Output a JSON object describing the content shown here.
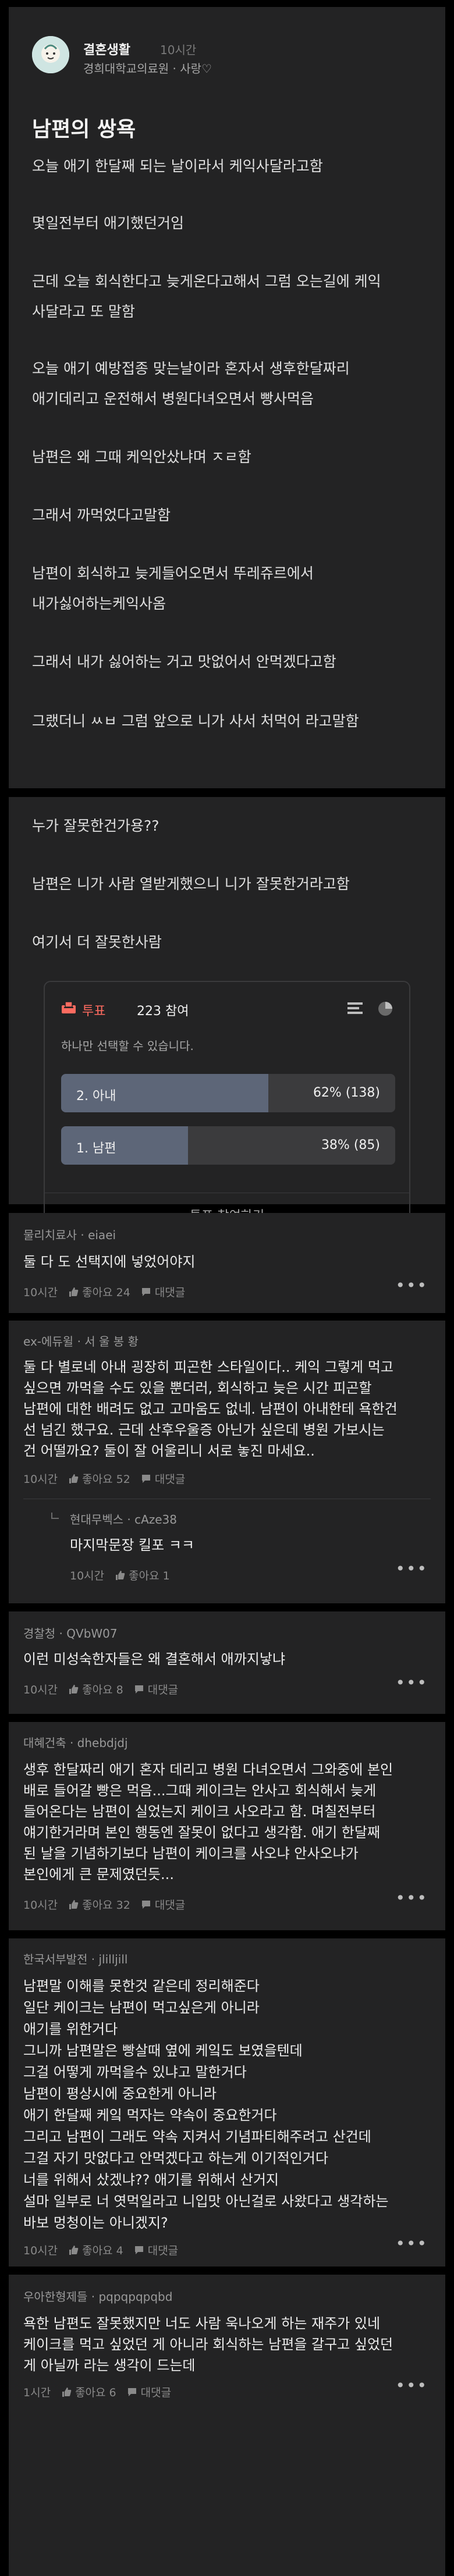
{
  "post": {
    "author": "결혼생활",
    "time": "10시간",
    "board": "경희대학교의료원 · 사랑♡",
    "title": "남편의 쌍욕",
    "lines": [
      "오늘 애기 한달째 되는 날이라서 케익사달라고함",
      "몇일전부터 애기했던거임",
      "근데 오늘 회식한다고 늦게온다고해서 그럼 오는길에 케익",
      "사달라고 또 말함",
      "오늘 애기 예방접종 맞는날이라 혼자서 생후한달짜리",
      "애기데리고 운전해서 병원다녀오면서 빵사먹음",
      "남편은 왜 그때 케익안샀냐며 ㅈㄹ함",
      "그래서 까먹었다고말함",
      "남편이 회식하고 늦게들어오면서 뚜레쥬르에서",
      "내가싫어하는케익사옴",
      "그래서 내가 싫어하는 거고 맛없어서 안먹겠다고함",
      "그랬더니 ㅆㅂ 그럼 앞으로 니가 사서 처먹어 라고말함"
    ]
  },
  "question": {
    "lines": [
      "누가 잘못한건가용??",
      "남편은 니가 사람 열받게했으니 니가 잘못한거라고함",
      "여기서 더 잘못한사람"
    ]
  },
  "poll": {
    "tag": "투표",
    "count": "223 참여",
    "note": "하나만 선택할 수 있습니다.",
    "options": [
      {
        "label": "2. 아내",
        "pct": "62% (138)",
        "fraction": 0.62
      },
      {
        "label": "1. 남편",
        "pct": "38% (85)",
        "fraction": 0.38
      }
    ],
    "join": "투표 참여하기"
  },
  "comments": [
    {
      "meta": "물리치료사 · eiaei",
      "lines": [
        "둘 다 도 선택지에 넣었어야지"
      ],
      "time": "10시간",
      "likes": "좋아요 24",
      "reply": "대댓글"
    },
    {
      "meta": "ex-에듀윌 · 서 울 봉 황",
      "lines": [
        "둘 다 별로네 아내 굉장히 피곤한 스타일이다.. 케익 그렇게 먹고",
        "싶으면 까먹을 수도 있을 뿐더러, 회식하고 늦은 시간 피곤할",
        "남편에 대한 배려도 없고 고마움도 없네. 남편이 아내한테 욕한건",
        "선 넘긴 했구요. 근데 산후우울증 아닌가 싶은데 병원 가보시는",
        "건 어떨까요? 둘이 잘 어울리니 서로 놓진 마세요.."
      ],
      "time": "10시간",
      "likes": "좋아요 52",
      "reply": "대댓글",
      "replies": [
        {
          "meta": "현대무벡스 · cAze38",
          "lines": [
            "마지막문장 킬포 ㅋㅋ"
          ],
          "time": "10시간",
          "likes": "좋아요 1"
        }
      ]
    },
    {
      "meta": "경찰청 · QVbW07",
      "lines": [
        "이런 미성숙한자들은 왜 결혼해서 애까지낳냐"
      ],
      "time": "10시간",
      "likes": "좋아요 8",
      "reply": "대댓글"
    },
    {
      "meta": "대혜건축 · dhebdjdj",
      "lines": [
        "생후 한달짜리 애기 혼자 데리고 병원 다녀오면서 그와중에 본인",
        "배로 들어갈 빵은 먹음...그때 케이크는 안사고 회식해서 늦게",
        "들어온다는 남편이 실었는지 케이크 사오라고 함. 며칠전부터",
        "얘기한거라며 본인 행동엔 잘못이 없다고 생각함. 애기 한달째",
        "된 날을 기념하기보다 남편이 케이크를 사오냐 안사오냐가",
        "본인에게 큰 문제였던듯..."
      ],
      "time": "10시간",
      "likes": "좋아요 32",
      "reply": "대댓글"
    },
    {
      "meta": "한국서부발전 · jlilljill",
      "lines": [
        "남편말 이해를 못한것 같은데 정리해준다",
        "일단 케이크는 남편이 먹고싶은게 아니라",
        "애기를 위한거다",
        "그니까 남편말은 빵살때 옆에 케잌도 보였을텐데",
        "그걸 어떻게 까먹을수 있냐고 말한거다",
        "남편이 평상시에 중요한게 아니라",
        "애기 한달째 케잌 먹자는 약속이 중요한거다",
        "그리고 남편이 그래도 약속 지켜서 기념파티해주려고 산건데",
        "그걸 자기 맛없다고 안먹겠다고 하는게 이기적인거다",
        "너를 위해서 샀겠냐?? 애기를 위해서 산거지",
        "설마 일부로 너 엿먹일라고 니입맛 아닌걸로 사왔다고 생각하는",
        "바보 멍청이는 아니겠지?"
      ],
      "time": "10시간",
      "likes": "좋아요 4",
      "reply": "대댓글"
    },
    {
      "meta": "우아한형제들 · pqpqpqpqbd",
      "lines": [
        "욕한 남편도 잘못했지만 너도 사람 욱나오게 하는 재주가 있네",
        "케이크를 먹고 싶었던 게 아니라 회식하는 남편을 갈구고 싶었던",
        "게 아닐까 라는 생각이 드는데"
      ],
      "time": "1시간",
      "likes": "좋아요 6",
      "reply": "대댓글"
    }
  ],
  "colors": {
    "background": "#000000",
    "card": "#232324",
    "accent_red": "#ff6b60",
    "poll_fill": "#5d6678"
  },
  "icons": {
    "like": "thumbs-up-icon",
    "reply": "comment-bubble-icon",
    "more": "more-dots-icon",
    "poll": "ballot-box-icon"
  }
}
